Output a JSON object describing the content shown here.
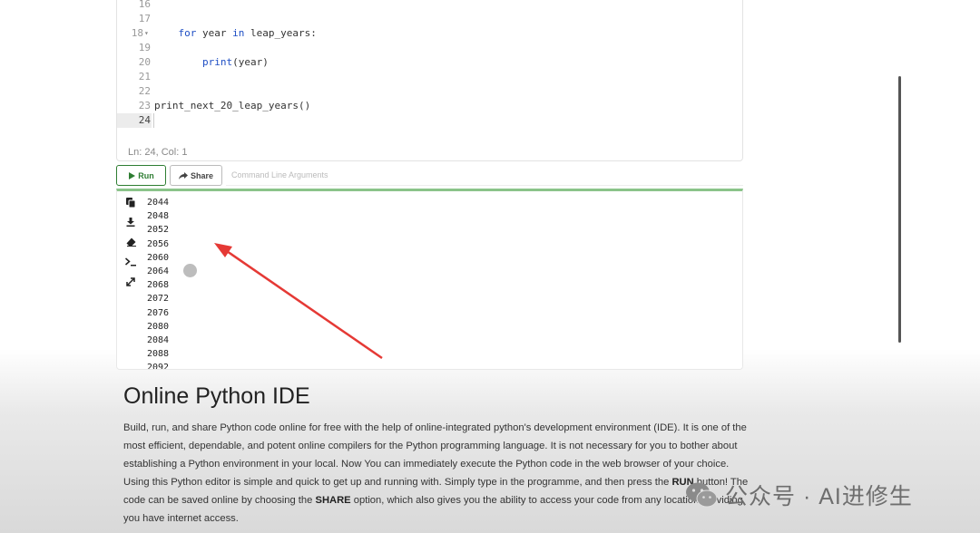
{
  "editor": {
    "lines": [
      {
        "num": "16",
        "text": ""
      },
      {
        "num": "17",
        "text": ""
      },
      {
        "num": "18",
        "text": "    for year in leap_years:",
        "fold": "▾"
      },
      {
        "num": "19",
        "text": ""
      },
      {
        "num": "20",
        "text": "        print(year)"
      },
      {
        "num": "21",
        "text": ""
      },
      {
        "num": "22",
        "text": ""
      },
      {
        "num": "23",
        "text": "print_next_20_leap_years()"
      },
      {
        "num": "24",
        "text": ""
      }
    ],
    "status": "Ln: 24,  Col: 1"
  },
  "toolbar": {
    "run_label": "Run",
    "share_label": "Share",
    "args_placeholder": "Command Line Arguments"
  },
  "console": {
    "icons": [
      "copy-icon",
      "download-icon",
      "eraser-icon",
      "terminal-icon",
      "expand-icon"
    ],
    "output": [
      "2044",
      "2048",
      "2052",
      "2056",
      "2060",
      "2064",
      "2068",
      "2072",
      "2076",
      "2080",
      "2084",
      "2088",
      "2092"
    ]
  },
  "annotation": {
    "arrow_color": "#e53935"
  },
  "description": {
    "title": "Online Python IDE",
    "p1": "Build, run, and share Python code online for free with the help of online-integrated python's development environment (IDE). It is one of the most efficient, dependable, and potent online compilers for the Python programming language. It is not necessary for you to bother about establishing a Python environment in your local. Now You can immediately execute the Python code in the web browser of your choice. Using this Python editor is simple and quick to get up and running with. Simply type in the programme, and then press the ",
    "run_word": "RUN",
    "p2": " button! The code can be saved online by choosing the ",
    "share_word": "SHARE",
    "p3": " option, which also gives you the ability to access your code from any location providing you have internet access."
  },
  "watermark": {
    "text": "公众号 · AI进修生"
  }
}
